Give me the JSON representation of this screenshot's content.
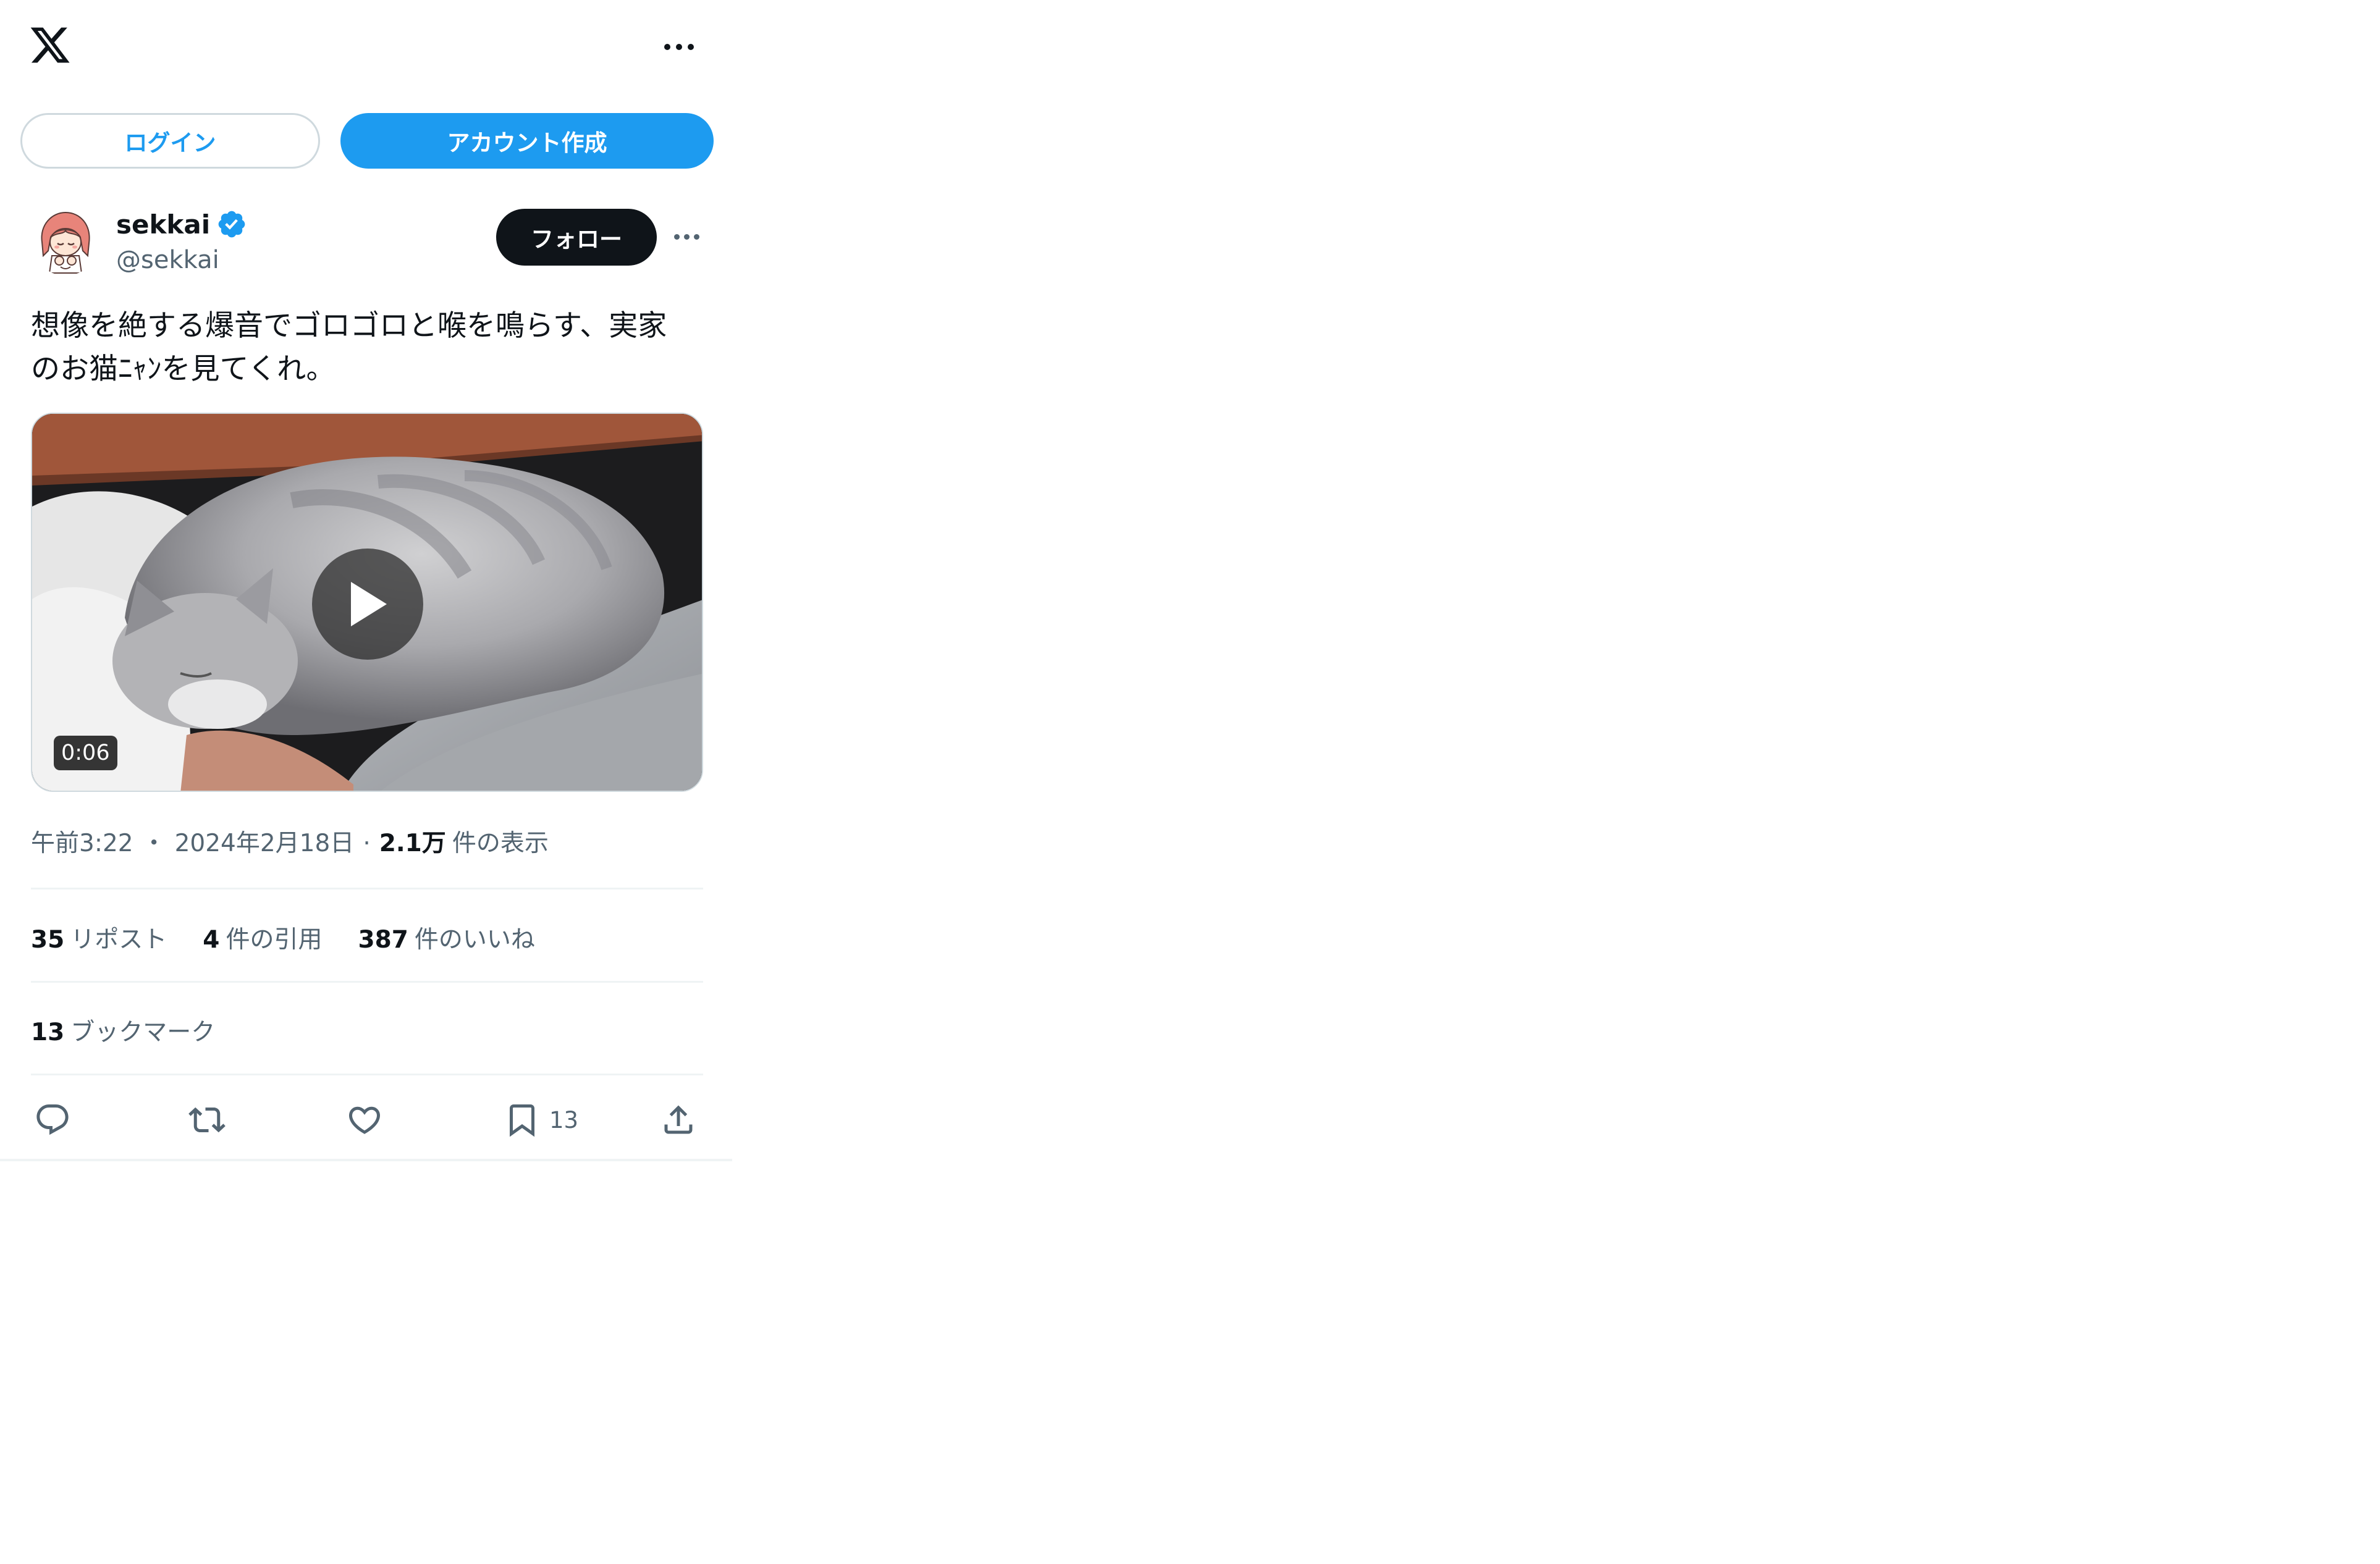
{
  "header": {
    "logo_icon": "x-logo-icon",
    "more_icon": "more-horizontal-icon"
  },
  "auth": {
    "login_label": "ログイン",
    "signup_label": "アカウント作成"
  },
  "tweet": {
    "author": {
      "display_name": "sekkai",
      "handle": "@sekkai",
      "verified": true
    },
    "follow_label": "フォロー",
    "text": "想像を絶する爆音でゴロゴロと喉を鳴らす、実家\nのお猫ﾆｬﾝを見てくれ。",
    "media": {
      "type": "video",
      "duration": "0:06"
    },
    "time": "午前3:22",
    "date": "2024年2月18日",
    "views_count": "2.1万",
    "views_label": "件の表示",
    "stats": {
      "reposts_count": "35",
      "reposts_label": "リポスト",
      "quotes_count": "4",
      "quotes_label": "件の引用",
      "likes_count": "387",
      "likes_label": "件のいいね",
      "bookmarks_count": "13",
      "bookmarks_label": "ブックマーク"
    },
    "actions": {
      "reply_icon": "reply-icon",
      "repost_icon": "repost-icon",
      "like_icon": "heart-icon",
      "bookmark_icon": "bookmark-icon",
      "bookmark_count": "13",
      "share_icon": "share-icon"
    }
  },
  "colors": {
    "accent": "#1d9bf0",
    "text_primary": "#0f1419",
    "text_secondary": "#536471",
    "border": "#cfd9de"
  }
}
